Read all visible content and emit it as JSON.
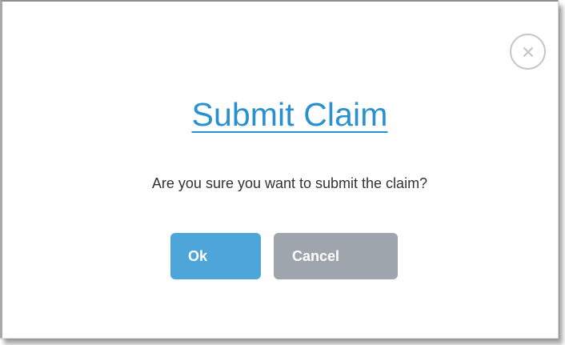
{
  "dialog": {
    "title": "Submit Claim",
    "message": "Are you sure you want to submit the claim?",
    "close_icon": "close-circle-icon",
    "buttons": {
      "ok_label": "Ok",
      "cancel_label": "Cancel"
    }
  },
  "colors": {
    "title": "#2a91d1",
    "ok_button": "#4ea5d9",
    "cancel_button": "#9fa5ac",
    "message_text": "#333333",
    "close_border": "#c6c6c6"
  }
}
